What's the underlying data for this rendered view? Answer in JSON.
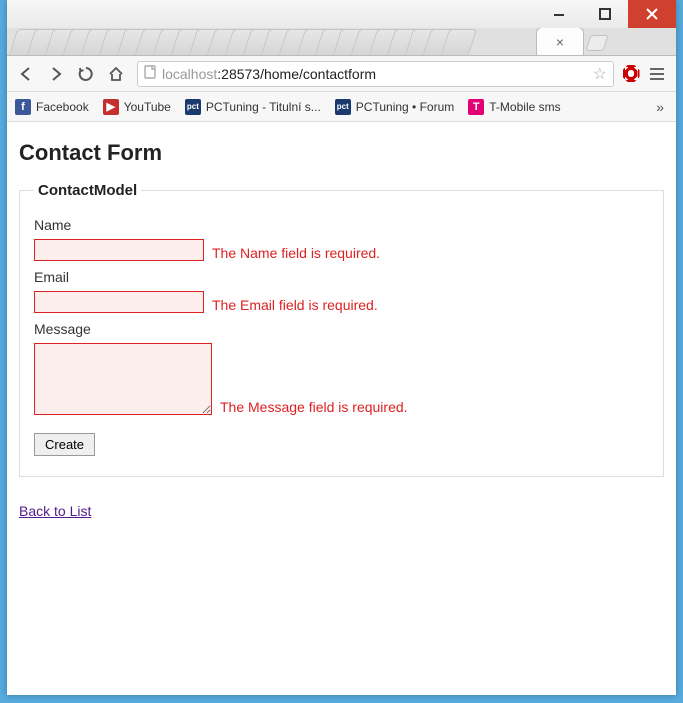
{
  "window": {
    "min_label": "minimize",
    "max_label": "maximize",
    "close_label": "close"
  },
  "tabs": {
    "active_close_hint": "×"
  },
  "toolbar": {
    "url_host": "localhost",
    "url_port_path": ":28573/home/contactform"
  },
  "bookmarks": [
    {
      "icon": "fb",
      "label": "Facebook"
    },
    {
      "icon": "yt",
      "label": "YouTube"
    },
    {
      "icon": "pct",
      "label": "PCTuning - Titulní s..."
    },
    {
      "icon": "pct",
      "label": "PCTuning • Forum"
    },
    {
      "icon": "tm",
      "label": "T-Mobile sms"
    }
  ],
  "page": {
    "heading": "Contact Form",
    "legend": "ContactModel",
    "fields": {
      "name": {
        "label": "Name",
        "value": "",
        "error": "The Name field is required."
      },
      "email": {
        "label": "Email",
        "value": "",
        "error": "The Email field is required."
      },
      "message": {
        "label": "Message",
        "value": "",
        "error": "The Message field is required."
      }
    },
    "submit_label": "Create",
    "back_link": "Back to List"
  }
}
